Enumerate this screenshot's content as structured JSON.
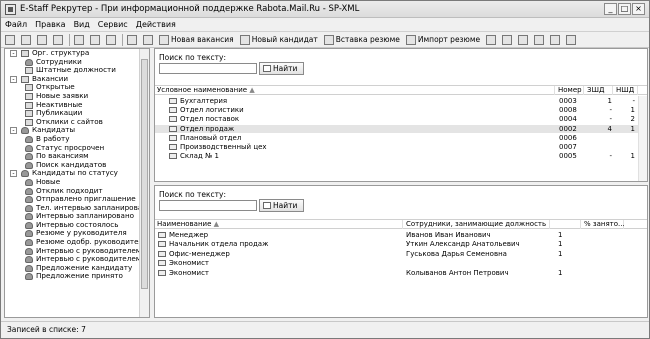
{
  "window": {
    "title": "E-Staff Рекрутер - При информационной поддержке Rabota.Mail.Ru - SP-XML",
    "controls": [
      "_",
      "□",
      "×"
    ]
  },
  "menu": [
    "Файл",
    "Правка",
    "Вид",
    "Сервис",
    "Действия"
  ],
  "toolbar": {
    "buttons": [
      "Новая вакансия",
      "Новый кандидат",
      "Вставка резюме",
      "Импорт резюме"
    ]
  },
  "tree": [
    {
      "label": "Орг. структура",
      "level": 0,
      "expander": "-",
      "icon": "org"
    },
    {
      "label": "Сотрудники",
      "level": 1,
      "icon": "person"
    },
    {
      "label": "Штатные должности",
      "level": 1,
      "icon": "doc"
    },
    {
      "label": "Вакансии",
      "level": 0,
      "expander": "-",
      "icon": "org"
    },
    {
      "label": "Открытые",
      "level": 1,
      "icon": "doc"
    },
    {
      "label": "Новые заявки",
      "level": 1,
      "icon": "doc"
    },
    {
      "label": "Неактивные",
      "level": 1,
      "icon": "doc"
    },
    {
      "label": "Публикации",
      "level": 1,
      "icon": "doc"
    },
    {
      "label": "Отклики с сайтов",
      "level": 1,
      "icon": "doc"
    },
    {
      "label": "Кандидаты",
      "level": 0,
      "expander": "-",
      "icon": "person"
    },
    {
      "label": "В работу",
      "level": 1,
      "icon": "person"
    },
    {
      "label": "Статус просрочен",
      "level": 1,
      "icon": "person"
    },
    {
      "label": "По вакансиям",
      "level": 1,
      "icon": "person"
    },
    {
      "label": "Поиск кандидатов",
      "level": 1,
      "icon": "person"
    },
    {
      "label": "Кандидаты по статусу",
      "level": 0,
      "expander": "-",
      "icon": "person"
    },
    {
      "label": "Новые",
      "level": 1,
      "icon": "person"
    },
    {
      "label": "Отклик подходит",
      "level": 1,
      "icon": "person"
    },
    {
      "label": "Отправлено приглашение",
      "level": 1,
      "icon": "person"
    },
    {
      "label": "Тел. интервью запланировано",
      "level": 1,
      "icon": "person"
    },
    {
      "label": "Интервью запланировано",
      "level": 1,
      "icon": "person"
    },
    {
      "label": "Интервью состоялось",
      "level": 1,
      "icon": "person"
    },
    {
      "label": "Резюме у руководителя",
      "level": 1,
      "icon": "person"
    },
    {
      "label": "Резюме одобр. руководителем",
      "level": 1,
      "icon": "person"
    },
    {
      "label": "Интервью с руководителем зап",
      "level": 1,
      "icon": "person"
    },
    {
      "label": "Интервью с руководителем сос",
      "level": 1,
      "icon": "person"
    },
    {
      "label": "Предложение кандидату",
      "level": 1,
      "icon": "person"
    },
    {
      "label": "Предложение принято",
      "level": 1,
      "icon": "person"
    }
  ],
  "top_panel": {
    "search_label": "Поиск по тексту:",
    "search_value": "",
    "search_button": "Найти",
    "columns": [
      "Условное наименование",
      "Номер",
      "ЗШД",
      "НШД"
    ],
    "sort_indicator": "▲",
    "rows": [
      {
        "name": "Бухгалтерия",
        "number": "0003",
        "zshd": "1",
        "nshd": "-"
      },
      {
        "name": "Отдел логистики",
        "number": "0008",
        "zshd": "-",
        "nshd": "1"
      },
      {
        "name": "Отдел поставок",
        "number": "0004",
        "zshd": "-",
        "nshd": "2"
      },
      {
        "name": "Отдел продаж",
        "number": "0002",
        "zshd": "4",
        "nshd": "1"
      },
      {
        "name": "Плановый отдел",
        "number": "0006",
        "zshd": "",
        "nshd": ""
      },
      {
        "name": "Производственный цех",
        "number": "0007",
        "zshd": "",
        "nshd": ""
      },
      {
        "name": "Склад № 1",
        "number": "0005",
        "zshd": "-",
        "nshd": "1"
      }
    ]
  },
  "bottom_panel": {
    "search_label": "Поиск по тексту:",
    "search_value": "",
    "search_button": "Найти",
    "columns": [
      "Наименование",
      "Сотрудники, занимающие должность",
      "",
      "% занято..."
    ],
    "sort_indicator": "▲",
    "rows": [
      {
        "name": "Менеджер",
        "employees": "Иванов Иван Иванович",
        "count": "1",
        "pct": ""
      },
      {
        "name": "Начальник отдела продаж",
        "employees": "Уткин Александр Анатольевич",
        "count": "1",
        "pct": ""
      },
      {
        "name": "Офис-менеджер",
        "employees": "Гуськова Дарья Семеновна",
        "count": "1",
        "pct": ""
      },
      {
        "name": "Экономист",
        "employees": "",
        "count": "",
        "pct": ""
      },
      {
        "name": "Экономист",
        "employees": "Колыванов Антон Петрович",
        "count": "1",
        "pct": ""
      }
    ]
  },
  "status": {
    "text": "Записей в списке: 7"
  }
}
